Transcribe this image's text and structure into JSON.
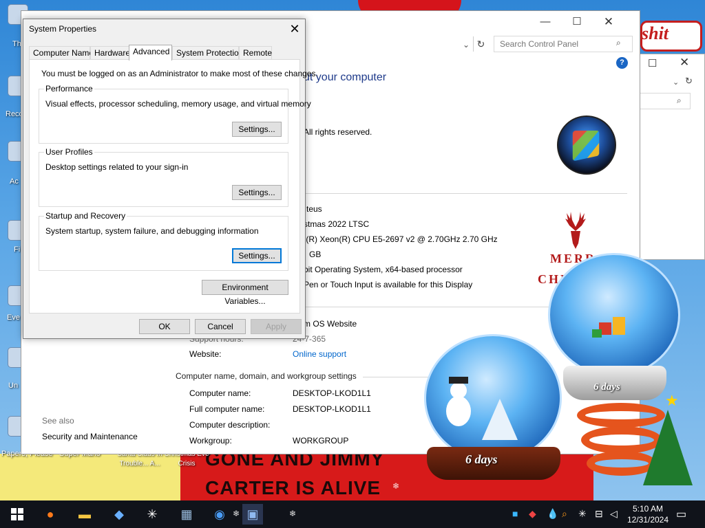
{
  "desktop": {
    "banner_line1": "GONE AND JIMMY",
    "banner_line2": "CARTER IS ALIVE",
    "corner_text": "shit",
    "icon_labels": [
      "Th",
      "Reco",
      "Ac",
      "Fi",
      "Eve",
      "Un",
      "Papers, Please",
      "Super Mario",
      "Santa Claus In Trouble... A...",
      "Christmas Eve Crisis"
    ]
  },
  "control_panel": {
    "search_placeholder": "Search Control Panel",
    "heading": "ut your computer",
    "copyright": "All rights reserved.",
    "system": {
      "manufacturer_fragment": "teus",
      "edition": "stmas 2022 LTSC",
      "processor": "I(R) Xeon(R) CPU E5-2697 v2 @ 2.70GHz   2.70 GHz",
      "ram": "GB",
      "system_type": "bit Operating System, x64-based processor",
      "pen_touch": "Pen or Touch Input is available for this Display"
    },
    "support": {
      "website_fragment": "m OS Website",
      "hours_label": "Support hours:",
      "hours_value": "24-7-365",
      "website_label": "Website:",
      "website_link": "Online support"
    },
    "computer_section_title": "Computer name, domain, and workgroup settings",
    "computer": [
      {
        "label": "Computer name:",
        "value": "DESKTOP-LKOD1L1"
      },
      {
        "label": "Full computer name:",
        "value": "DESKTOP-LKOD1L1"
      },
      {
        "label": "Computer description:",
        "value": ""
      },
      {
        "label": "Workgroup:",
        "value": "WORKGROUP"
      }
    ],
    "see_also": "See also",
    "security_link": "Security and Maintenance",
    "merry": "MERR",
    "christmas": "CHR"
  },
  "dialog": {
    "title": "System Properties",
    "tabs": [
      "Computer Name",
      "Hardware",
      "Advanced",
      "System Protection",
      "Remote"
    ],
    "active_tab": "Advanced",
    "admin_note": "You must be logged on as an Administrator to make most of these changes.",
    "performance": {
      "label": "Performance",
      "desc": "Visual effects, processor scheduling, memory usage, and virtual memory",
      "button": "Settings..."
    },
    "user_profiles": {
      "label": "User Profiles",
      "desc": "Desktop settings related to your sign-in",
      "button": "Settings..."
    },
    "startup": {
      "label": "Startup and Recovery",
      "desc": "System startup, system failure, and debugging information",
      "button": "Settings..."
    },
    "env_button": "Environment Variables...",
    "ok": "OK",
    "cancel": "Cancel",
    "apply": "Apply"
  },
  "globes": {
    "left_days": "6 days",
    "right_days": "6 days"
  },
  "taskbar": {
    "time": "5:10 AM",
    "date": "12/31/2024"
  }
}
